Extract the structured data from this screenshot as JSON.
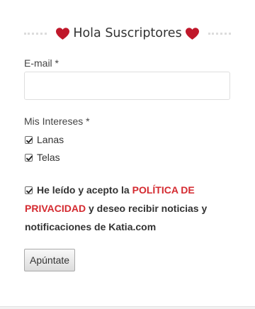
{
  "form": {
    "title": "Hola Suscriptores",
    "title_icon": "heart-icon",
    "accent_color": "#c0182b",
    "email": {
      "label": "E-mail *",
      "value": "",
      "placeholder": ""
    },
    "interests": {
      "label": "Mis Intereses *",
      "options": [
        {
          "label": "Lanas",
          "checked": true
        },
        {
          "label": "Telas",
          "checked": true
        }
      ]
    },
    "consent": {
      "checked": true,
      "text_before": "He leído y acepto la ",
      "link_text": "POLÍTICA DE PRIVACIDAD",
      "text_after": " y deseo recibir noticias y notificaciones de Katia.com",
      "link_color": "#d42a30"
    },
    "submit_label": "Apúntate"
  }
}
